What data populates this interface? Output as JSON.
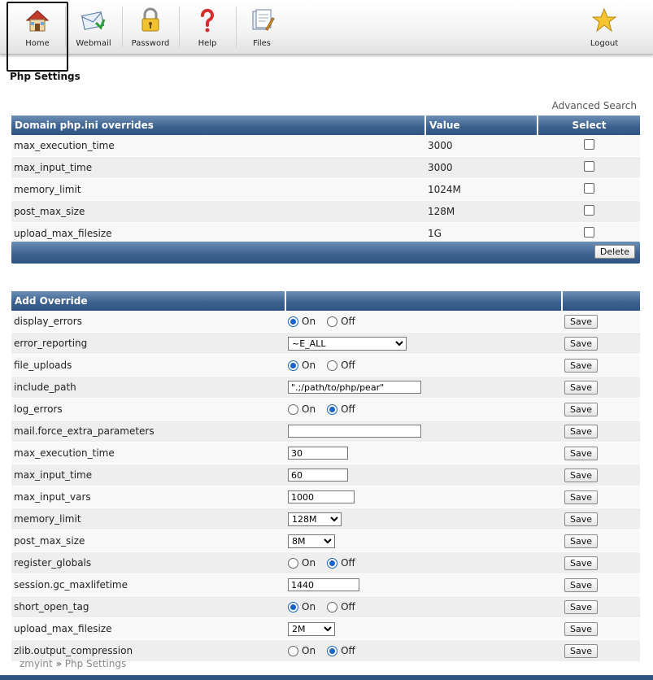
{
  "nav": {
    "items": [
      {
        "id": "home",
        "label": "Home",
        "icon": "house-icon"
      },
      {
        "id": "webmail",
        "label": "Webmail",
        "icon": "mail-icon"
      },
      {
        "id": "password",
        "label": "Password",
        "icon": "lock-icon"
      },
      {
        "id": "help",
        "label": "Help",
        "icon": "question-icon"
      },
      {
        "id": "files",
        "label": "Files",
        "icon": "files-icon"
      }
    ],
    "logout_label": "Logout"
  },
  "page": {
    "title": "Php Settings",
    "advanced_search": "Advanced Search"
  },
  "overrides": {
    "headers": [
      "Domain php.ini overrides",
      "Value",
      "Select"
    ],
    "rows": [
      {
        "name": "max_execution_time",
        "value": "3000"
      },
      {
        "name": "max_input_time",
        "value": "3000"
      },
      {
        "name": "memory_limit",
        "value": "1024M"
      },
      {
        "name": "post_max_size",
        "value": "128M"
      },
      {
        "name": "upload_max_filesize",
        "value": "1G"
      }
    ],
    "delete_label": "Delete"
  },
  "add": {
    "header": "Add Override",
    "on_label": "On",
    "off_label": "Off",
    "save_label": "Save",
    "rows": [
      {
        "name": "display_errors",
        "type": "radio",
        "value": "On"
      },
      {
        "name": "error_reporting",
        "type": "select",
        "value": "~E_ALL"
      },
      {
        "name": "file_uploads",
        "type": "radio",
        "value": "On"
      },
      {
        "name": "include_path",
        "type": "text",
        "value": "\".;/path/to/php/pear\""
      },
      {
        "name": "log_errors",
        "type": "radio",
        "value": "Off"
      },
      {
        "name": "mail.force_extra_parameters",
        "type": "text",
        "value": ""
      },
      {
        "name": "max_execution_time",
        "type": "text",
        "value": "30"
      },
      {
        "name": "max_input_time",
        "type": "text",
        "value": "60"
      },
      {
        "name": "max_input_vars",
        "type": "text",
        "value": "1000"
      },
      {
        "name": "memory_limit",
        "type": "select",
        "value": "128M"
      },
      {
        "name": "post_max_size",
        "type": "select",
        "value": "8M"
      },
      {
        "name": "register_globals",
        "type": "radio",
        "value": "Off"
      },
      {
        "name": "session.gc_maxlifetime",
        "type": "text",
        "value": "1440"
      },
      {
        "name": "short_open_tag",
        "type": "radio",
        "value": "On"
      },
      {
        "name": "upload_max_filesize",
        "type": "select",
        "value": "2M"
      },
      {
        "name": "zlib.output_compression",
        "type": "radio",
        "value": "Off"
      }
    ]
  },
  "breadcrumb": {
    "user": "zmyint",
    "separator": "»",
    "current": "Php Settings"
  }
}
